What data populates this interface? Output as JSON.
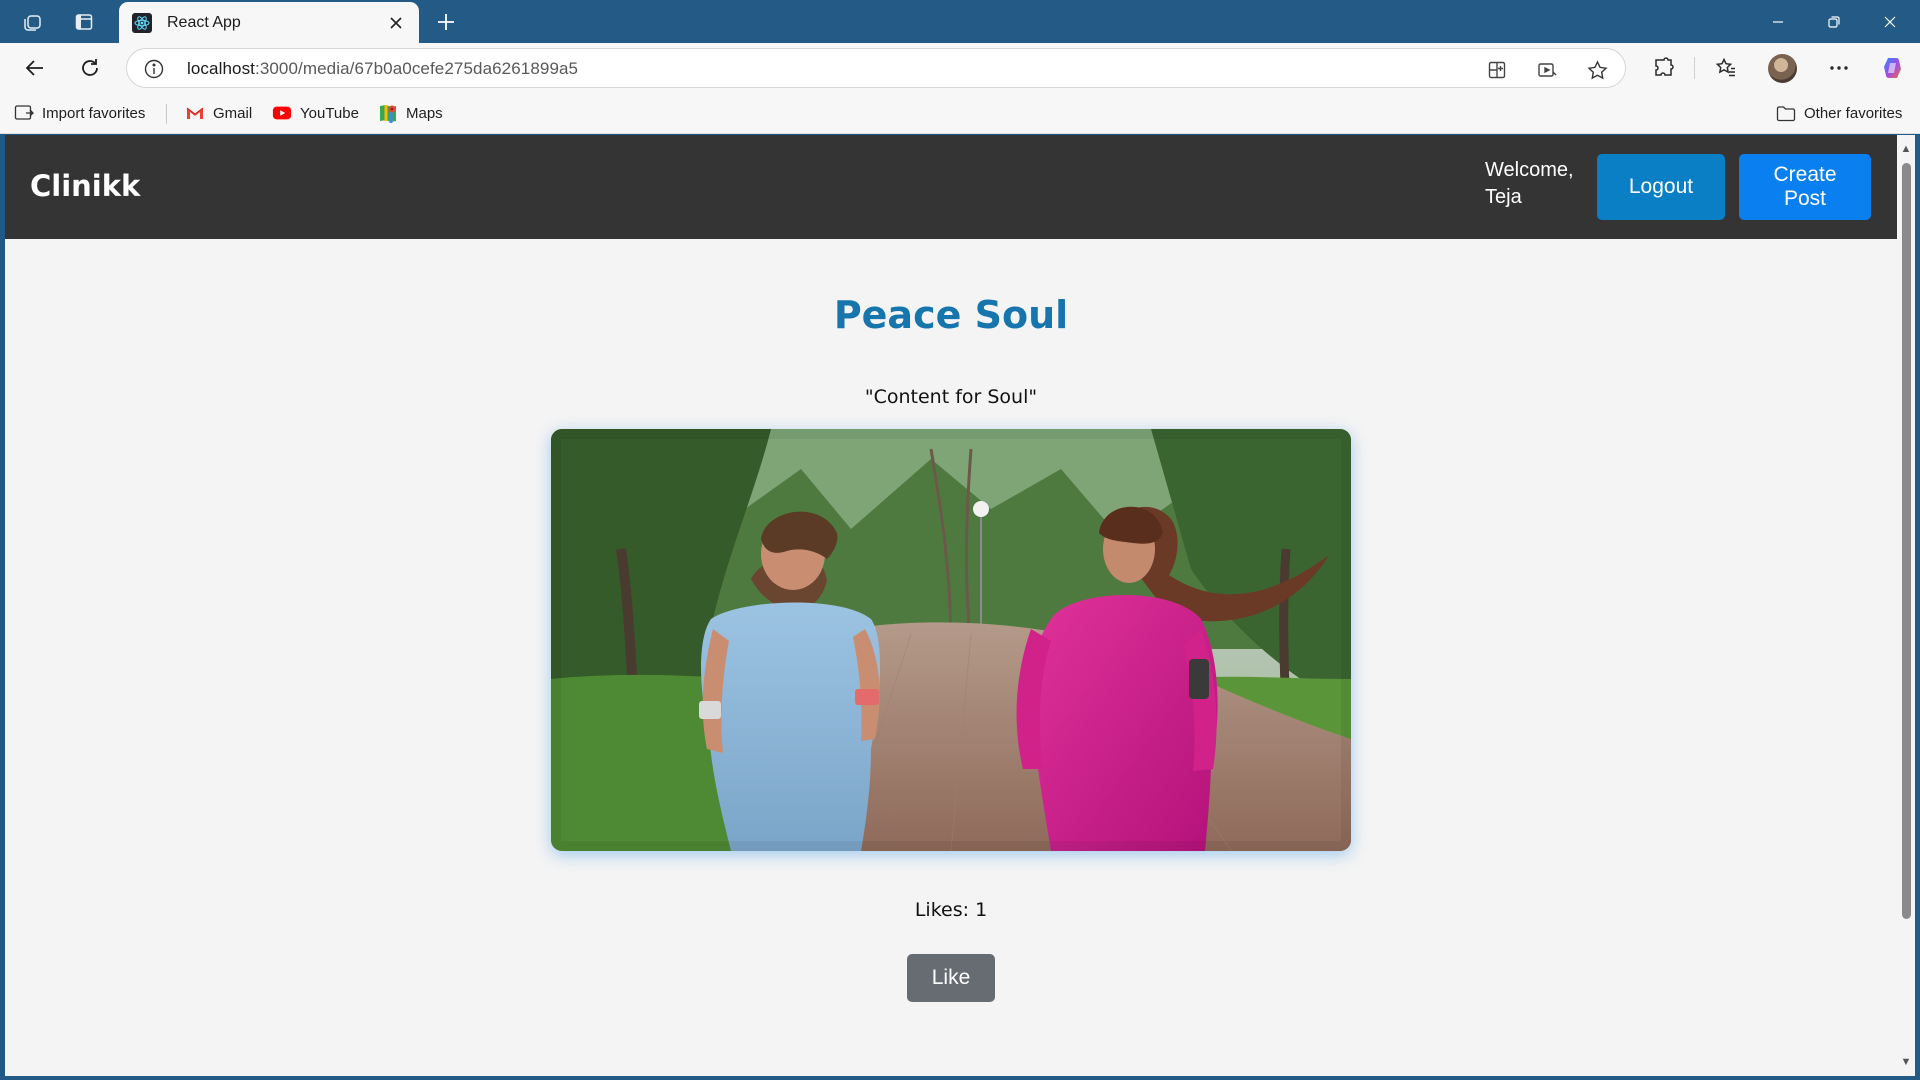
{
  "browser": {
    "tab_title": "React App",
    "url_host": "localhost",
    "url_path": ":3000/media/67b0a0cefe275da6261899a5",
    "bookmarks": [
      {
        "label": "Import favorites",
        "icon": "import-favorites-icon"
      },
      {
        "label": "Gmail",
        "icon": "gmail-icon"
      },
      {
        "label": "YouTube",
        "icon": "youtube-icon"
      },
      {
        "label": "Maps",
        "icon": "maps-icon"
      }
    ],
    "other_favorites": "Other favorites"
  },
  "app": {
    "brand": "Clinikk",
    "welcome": "Welcome, Teja",
    "logout_label": "Logout",
    "create_post_label": "Create Post",
    "colors": {
      "navbar": "#343434",
      "logout": "#0a7fc6",
      "create_post": "#0a7ff0",
      "title": "#1675ad",
      "like_button": "#666c72"
    }
  },
  "post": {
    "title": "Peace Soul",
    "description": "\"Content for Soul\"",
    "likes_text": "Likes: 1",
    "like_label": "Like"
  }
}
